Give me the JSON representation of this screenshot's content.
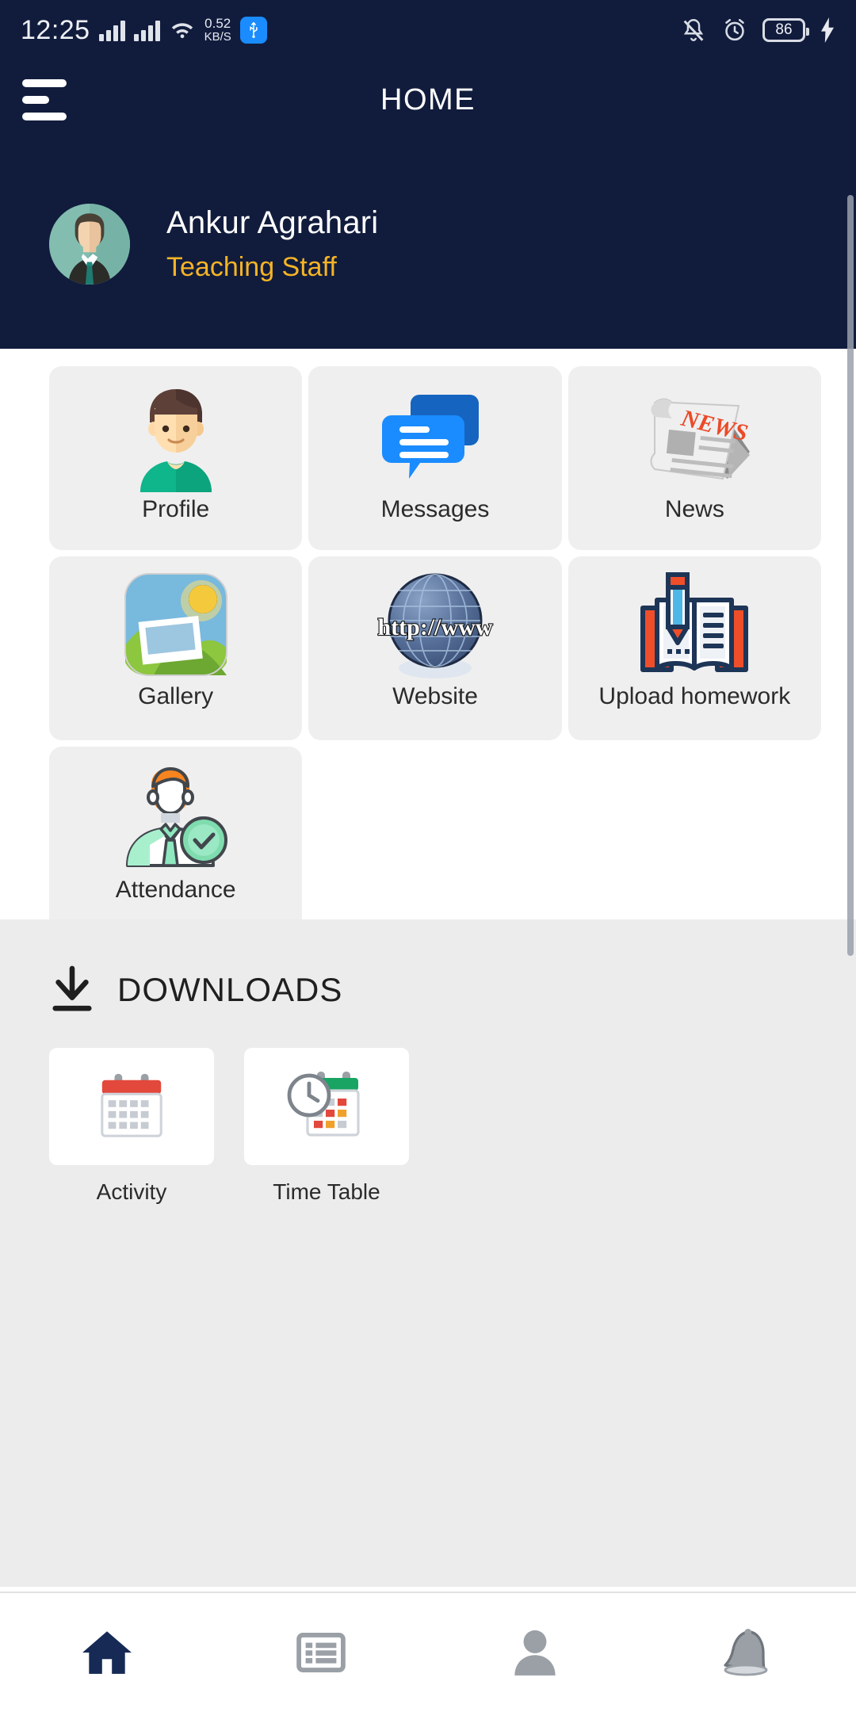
{
  "statusbar": {
    "time": "12:25",
    "net_speed_value": "0.52",
    "net_speed_unit": "KB/S",
    "battery_level": "86",
    "icons": [
      "signal-bars-sim1",
      "signal-bars-sim2",
      "wifi-icon",
      "usb-icon",
      "mute-bell-icon",
      "alarm-clock-icon",
      "battery-icon",
      "charging-bolt-icon"
    ]
  },
  "appbar": {
    "menu_icon": "hamburger-menu-icon",
    "title": "HOME"
  },
  "profile": {
    "name": "Ankur Agrahari",
    "role": "Teaching Staff",
    "avatar": "user-avatar"
  },
  "grid": {
    "items": [
      {
        "label": "Profile",
        "icon": "profile-boy-icon"
      },
      {
        "label": "Messages",
        "icon": "chat-bubbles-icon"
      },
      {
        "label": "News",
        "icon": "newspaper-icon",
        "icon_text": "NEWS"
      },
      {
        "label": "Gallery",
        "icon": "photo-gallery-icon"
      },
      {
        "label": "Website",
        "icon": "globe-icon",
        "icon_text": "http://www"
      },
      {
        "label": "Upload homework",
        "icon": "book-pencil-icon"
      },
      {
        "label": "Attendance",
        "icon": "person-check-icon"
      }
    ]
  },
  "downloads": {
    "title": "DOWNLOADS",
    "icon": "download-arrow-icon",
    "items": [
      {
        "label": "Activity",
        "icon": "calendar-icon"
      },
      {
        "label": "Time Table",
        "icon": "clock-calendar-icon"
      }
    ]
  },
  "bottomnav": {
    "items": [
      {
        "name": "home",
        "icon": "home-icon",
        "active": true
      },
      {
        "name": "list",
        "icon": "list-icon",
        "active": false
      },
      {
        "name": "account",
        "icon": "person-icon",
        "active": false
      },
      {
        "name": "notifications",
        "icon": "bell-icon",
        "active": false
      }
    ]
  },
  "colors": {
    "header_navy": "#111c3d",
    "accent_gold": "#f5b425",
    "tile_grey": "#efefef",
    "downloads_grey": "#ececec",
    "nav_active": "#162a55"
  }
}
